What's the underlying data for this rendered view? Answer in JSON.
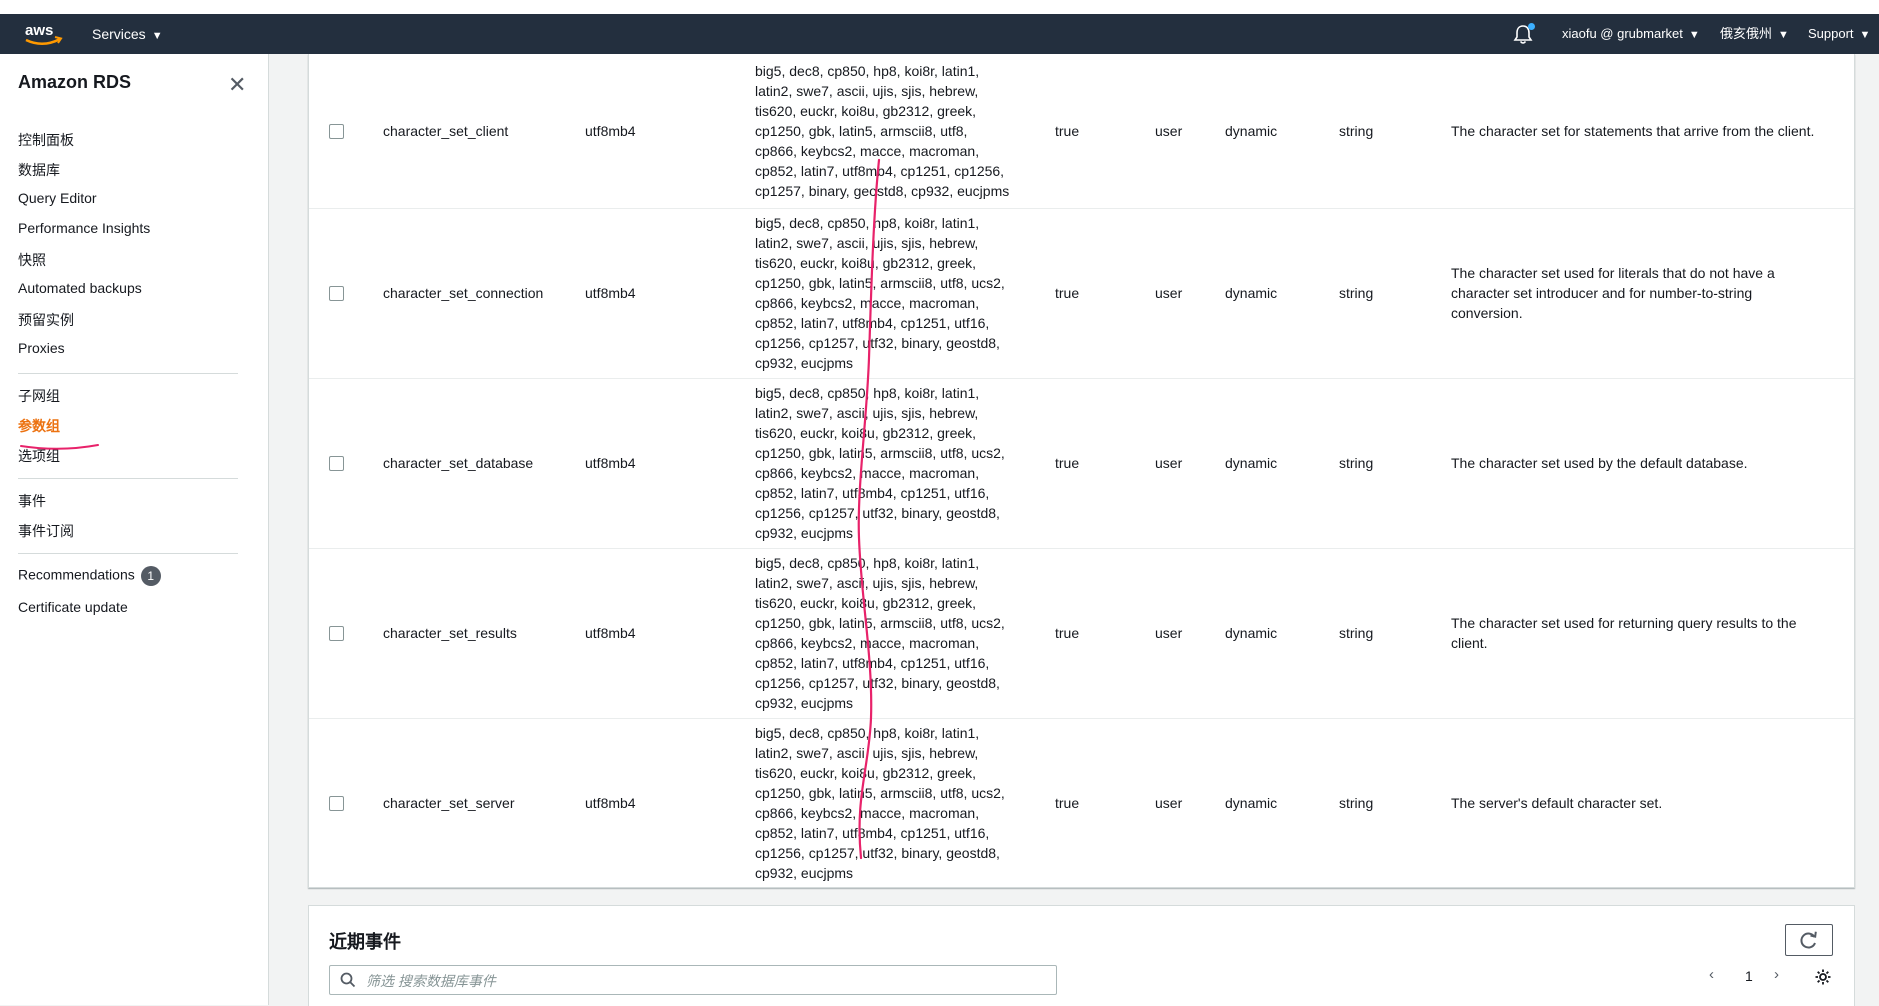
{
  "topnav": {
    "services_label": "Services",
    "user_label": "xiaofu @ grubmarket",
    "region_label": "俄亥俄州",
    "support_label": "Support"
  },
  "sidebar": {
    "title": "Amazon RDS",
    "groups": [
      [
        "控制面板",
        "数据库",
        "Query Editor",
        "Performance Insights",
        "快照",
        "Automated backups",
        "预留实例",
        "Proxies"
      ],
      [
        "子网组",
        "参数组",
        "选项组"
      ],
      [
        "事件",
        "事件订阅"
      ],
      [
        "Recommendations",
        "Certificate update"
      ]
    ],
    "active_item": "参数组",
    "recommendations_badge": "1"
  },
  "table": {
    "rows": [
      {
        "name": "character_set_client",
        "value": "utf8mb4",
        "allowed_lines": [
          "big5, dec8, cp850, hp8, koi8r, latin1,",
          "latin2, swe7, ascii, ujis, sjis, hebrew,",
          "tis620, euckr, koi8u, gb2312, greek,",
          "cp1250, gbk, latin5, armscii8, utf8,",
          "cp866, keybcs2, macce, macroman,",
          "cp852, latin7, utf8mb4, cp1251, cp1256,",
          "cp1257, binary, geostd8, cp932, eucjpms"
        ],
        "modifiable": "true",
        "source": "user",
        "apply_type": "dynamic",
        "data_type": "string",
        "description_lines": [
          "The character set for statements that arrive from the client."
        ]
      },
      {
        "name": "character_set_connection",
        "value": "utf8mb4",
        "allowed_lines": [
          "big5, dec8, cp850, hp8, koi8r, latin1,",
          "latin2, swe7, ascii, ujis, sjis, hebrew,",
          "tis620, euckr, koi8u, gb2312, greek,",
          "cp1250, gbk, latin5, armscii8, utf8, ucs2,",
          "cp866, keybcs2, macce, macroman,",
          "cp852, latin7, utf8mb4, cp1251, utf16,",
          "cp1256, cp1257, utf32, binary, geostd8,",
          "cp932, eucjpms"
        ],
        "modifiable": "true",
        "source": "user",
        "apply_type": "dynamic",
        "data_type": "string",
        "description_lines": [
          "The character set used for literals that do not have a",
          "character set introducer and for number-to-string",
          "conversion."
        ]
      },
      {
        "name": "character_set_database",
        "value": "utf8mb4",
        "allowed_lines": [
          "big5, dec8, cp850, hp8, koi8r, latin1,",
          "latin2, swe7, ascii, ujis, sjis, hebrew,",
          "tis620, euckr, koi8u, gb2312, greek,",
          "cp1250, gbk, latin5, armscii8, utf8, ucs2,",
          "cp866, keybcs2, macce, macroman,",
          "cp852, latin7, utf8mb4, cp1251, utf16,",
          "cp1256, cp1257, utf32, binary, geostd8,",
          "cp932, eucjpms"
        ],
        "modifiable": "true",
        "source": "user",
        "apply_type": "dynamic",
        "data_type": "string",
        "description_lines": [
          "The character set used by the default database."
        ]
      },
      {
        "name": "character_set_results",
        "value": "utf8mb4",
        "allowed_lines": [
          "big5, dec8, cp850, hp8, koi8r, latin1,",
          "latin2, swe7, ascii, ujis, sjis, hebrew,",
          "tis620, euckr, koi8u, gb2312, greek,",
          "cp1250, gbk, latin5, armscii8, utf8, ucs2,",
          "cp866, keybcs2, macce, macroman,",
          "cp852, latin7, utf8mb4, cp1251, utf16,",
          "cp1256, cp1257, utf32, binary, geostd8,",
          "cp932, eucjpms"
        ],
        "modifiable": "true",
        "source": "user",
        "apply_type": "dynamic",
        "data_type": "string",
        "description_lines": [
          "The character set used for returning query results to the",
          "client."
        ]
      },
      {
        "name": "character_set_server",
        "value": "utf8mb4",
        "allowed_lines": [
          "big5, dec8, cp850, hp8, koi8r, latin1,",
          "latin2, swe7, ascii, ujis, sjis, hebrew,",
          "tis620, euckr, koi8u, gb2312, greek,",
          "cp1250, gbk, latin5, armscii8, utf8, ucs2,",
          "cp866, keybcs2, macce, macroman,",
          "cp852, latin7, utf8mb4, cp1251, utf16,",
          "cp1256, cp1257, utf32, binary, geostd8,",
          "cp932, eucjpms"
        ],
        "modifiable": "true",
        "source": "user",
        "apply_type": "dynamic",
        "data_type": "string",
        "description_lines": [
          "The server's default character set."
        ]
      }
    ]
  },
  "events": {
    "title": "近期事件",
    "search_placeholder": "筛选 搜索数据库事件",
    "page_number": "1"
  },
  "colors": {
    "nav_bg": "#232f3e",
    "active_orange": "#ec7211",
    "annotation_pink": "#e8226a"
  }
}
